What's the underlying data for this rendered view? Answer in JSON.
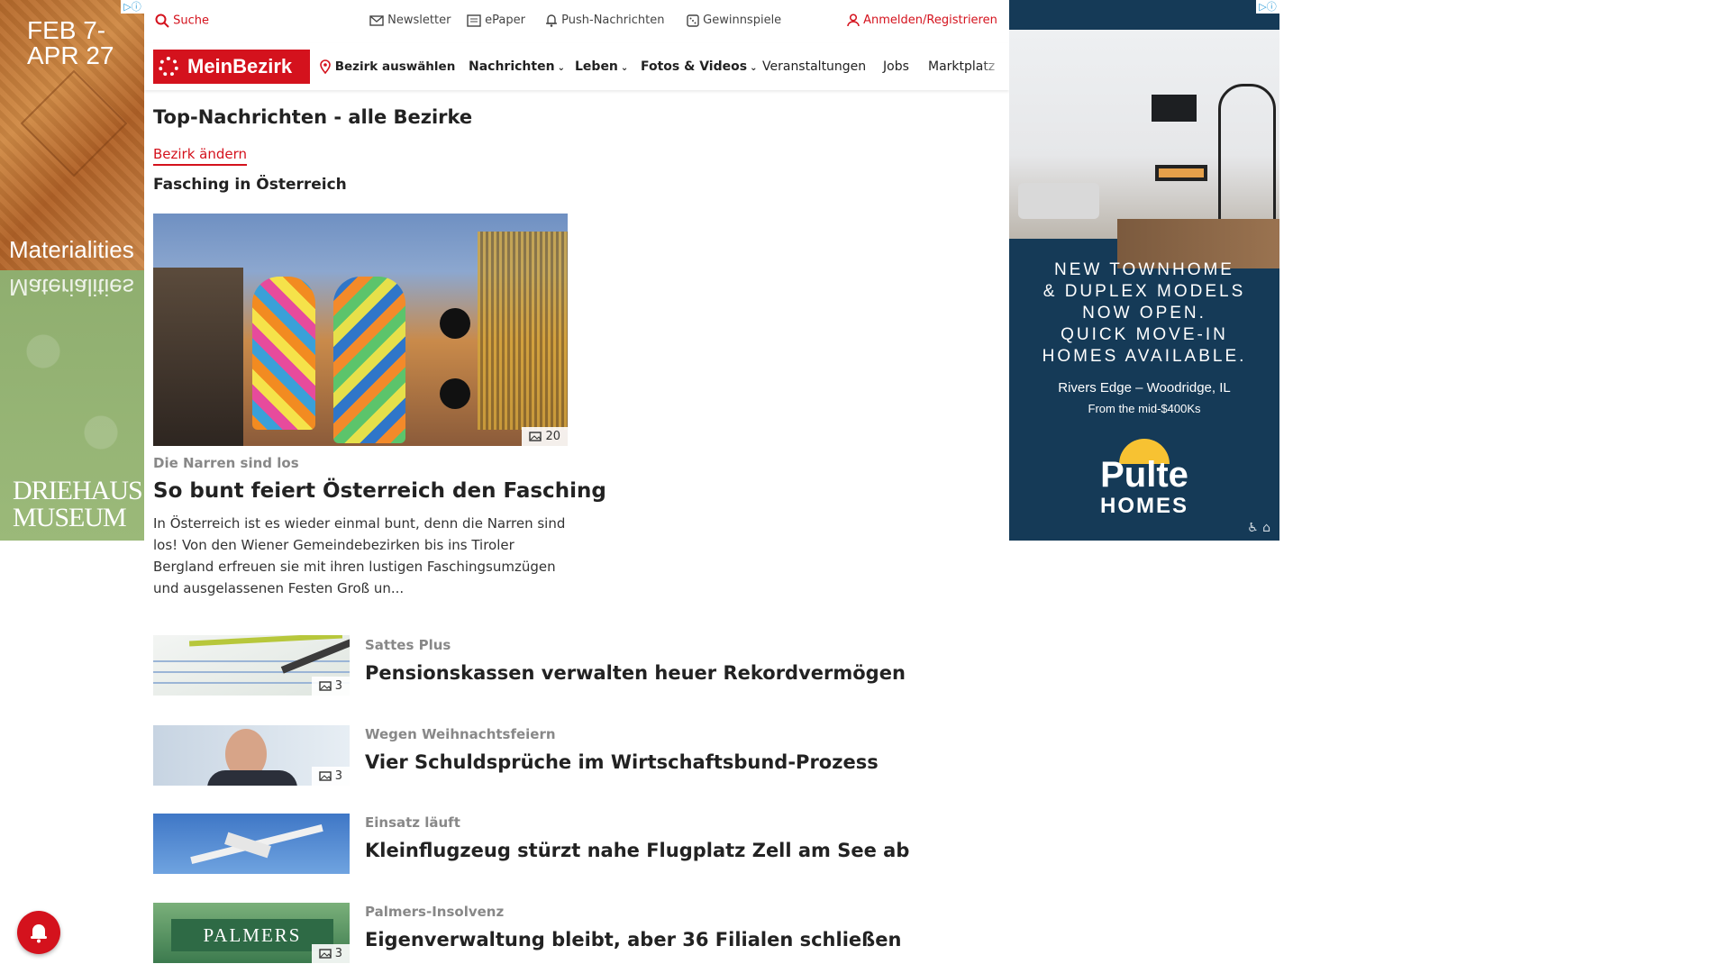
{
  "ads": {
    "left": {
      "date_line1": "FEB 7-",
      "date_line2": "APR 27",
      "brand_word": "Materialities",
      "museum_line1": "DRIEHAUS",
      "museum_line2": "MUSEUM"
    },
    "right": {
      "headline_lines": [
        "NEW TOWNHOME",
        "& DUPLEX MODELS",
        "NOW OPEN.",
        "QUICK MOVE-IN",
        "HOMES AVAILABLE."
      ],
      "location": "Rivers Edge – Woodridge, IL",
      "price": "From the mid-$400Ks",
      "logo_top": "Pulte",
      "logo_bottom": "HOMES"
    }
  },
  "topbar": {
    "search": "Suche",
    "newsletter": "Newsletter",
    "epaper": "ePaper",
    "push": "Push-Nachrichten",
    "gewinnspiele": "Gewinnspiele",
    "login": "Anmelden/Registrieren"
  },
  "nav": {
    "logo": "MeinBezirk",
    "bezirk": "Bezirk auswählen",
    "items": [
      "Nachrichten",
      "Leben",
      "Fotos & Videos",
      "Veranstaltungen",
      "Jobs",
      "Marktplatz"
    ]
  },
  "page": {
    "title": "Top-Nachrichten - alle Bezirke",
    "change_link": "Bezirk ändern",
    "section": "Fasching in Österreich"
  },
  "hero": {
    "photo_count": "20",
    "kicker": "Die Narren sind los",
    "title": "So bunt feiert Österreich den Fasching",
    "teaser": "In Österreich ist es wieder einmal bunt, denn die Narren sind los! Von den Wiener Gemeindebezirken bis ins Tiroler Bergland erfreuen sie mit ihren lustigen Faschingsumzügen und ausgelassenen Festen Groß un..."
  },
  "articles": [
    {
      "kicker": "Sattes Plus",
      "title": "Pensionskassen verwalten heuer Rekordvermögen",
      "photo_count": "3"
    },
    {
      "kicker": "Wegen Weihnachtsfeiern",
      "title": "Vier Schuldsprüche im Wirtschaftsbund-Prozess",
      "photo_count": "3"
    },
    {
      "kicker": "Einsatz läuft",
      "title": "Kleinflugzeug stürzt nahe Flugplatz Zell am See ab",
      "photo_count": ""
    },
    {
      "kicker": "Palmers-Insolvenz",
      "title": "Eigenverwaltung bleibt, aber 36 Filialen schließen",
      "photo_count": "3",
      "image_text": "PALMERS"
    }
  ],
  "colors": {
    "brand": "#d4121d",
    "ad_navy": "#153a57"
  }
}
